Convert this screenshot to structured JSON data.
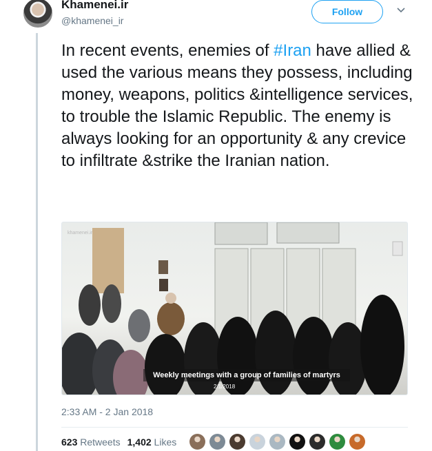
{
  "author": {
    "display_name": "Khamenei.ir",
    "handle": "@khamenei_ir",
    "follow_label": "Follow"
  },
  "tweet": {
    "text_before": "In recent events, enemies of ",
    "hashtag": "#Iran",
    "text_after": " have allied & used the various means they possess, including money, weapons, politics &intelligence services, to trouble the Islamic Republic. The enemy is always looking for an opportunity & any crevice to infiltrate &strike the Iranian nation.",
    "timestamp": "2:33 AM - 2 Jan 2018"
  },
  "media": {
    "watermark": "khamenei.ir",
    "caption": "Weekly meetings with a group of families of martyrs",
    "date": "2/1/2018"
  },
  "stats": {
    "retweets_count": "623",
    "retweets_label": "Retweets",
    "likes_count": "1,402",
    "likes_label": "Likes"
  },
  "likers": [
    {
      "name": "liker-avatar-1",
      "color": "#8a6f5a"
    },
    {
      "name": "liker-avatar-2",
      "color": "#7d8a95"
    },
    {
      "name": "liker-avatar-3",
      "color": "#4b3b30"
    },
    {
      "name": "liker-avatar-4",
      "color": "#c9d3dc"
    },
    {
      "name": "liker-avatar-5",
      "color": "#aab8c2"
    },
    {
      "name": "liker-avatar-6",
      "color": "#111111"
    },
    {
      "name": "liker-avatar-7",
      "color": "#2b2b2b"
    },
    {
      "name": "liker-avatar-8",
      "color": "#2e8b3e"
    },
    {
      "name": "liker-avatar-9",
      "color": "#c76a2a"
    }
  ],
  "colors": {
    "accent": "#1da1f2",
    "secondary_text": "#657786",
    "thread_line": "#ccd6dd"
  }
}
